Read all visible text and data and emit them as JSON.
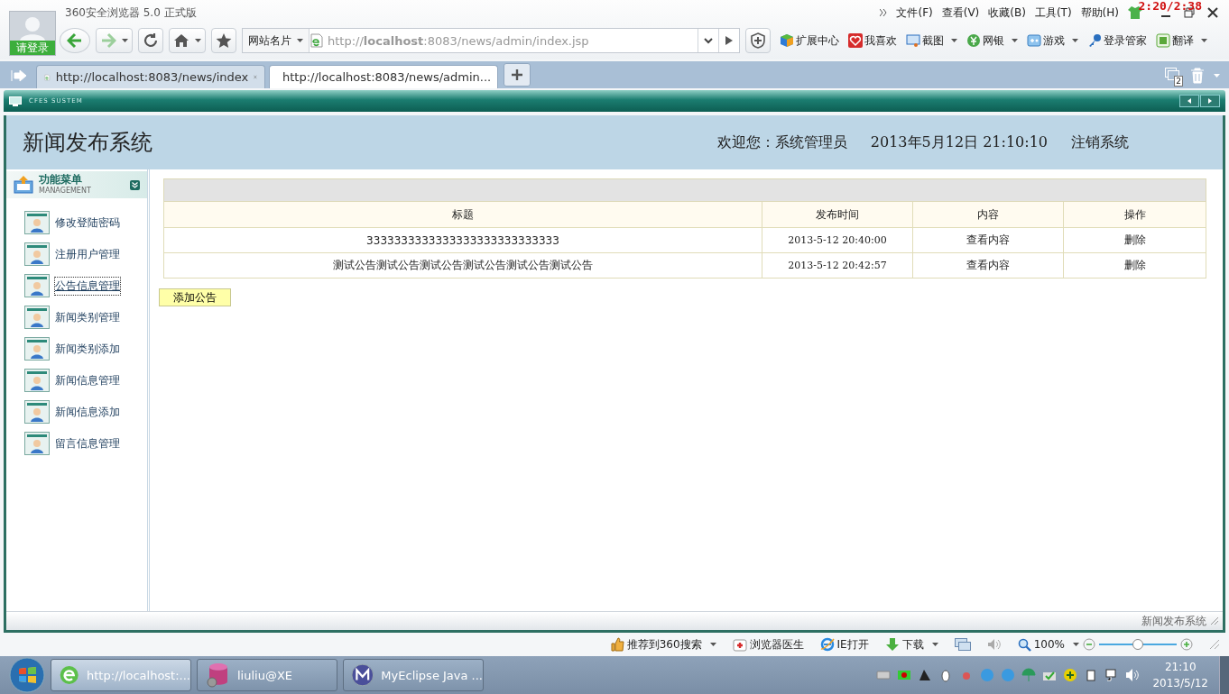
{
  "browser": {
    "title": "360安全浏览器 5.0 正式版",
    "login_label": "请登录",
    "timer": "2:20/2:38",
    "menu": [
      "文件(F)",
      "查看(V)",
      "收藏(B)",
      "工具(T)",
      "帮助(H)"
    ],
    "site_card": "网站名片",
    "address": "http://**localhost**:8083/news/admin/index.jsp",
    "toolbar_items": [
      {
        "kind": "cube",
        "label": "扩展中心",
        "dropdown": false
      },
      {
        "kind": "heart",
        "label": "我喜欢",
        "dropdown": false
      },
      {
        "kind": "screen",
        "label": "截图",
        "dropdown": true
      },
      {
        "kind": "coin",
        "label": "网银",
        "dropdown": true
      },
      {
        "kind": "game",
        "label": "游戏",
        "dropdown": true
      },
      {
        "kind": "key",
        "label": "登录管家",
        "dropdown": false
      },
      {
        "kind": "translate",
        "label": "翻译",
        "dropdown": true
      }
    ],
    "tabs": [
      {
        "label": "http://localhost:8083/news/index",
        "selected": false
      },
      {
        "label": "http://localhost:8083/news/admin...",
        "selected": true
      }
    ],
    "window_count": "2"
  },
  "app": {
    "banner": "CFES SUSTEM",
    "title": "新闻发布系统",
    "welcome": "欢迎您：系统管理员",
    "datetime": "2013年5月12日  21:10:10",
    "logout": "注销系统",
    "menu_title": "功能菜单",
    "menu_subtitle": "MANAGEMENT",
    "menu_items": [
      {
        "label": "修改登陆密码",
        "selected": false
      },
      {
        "label": "注册用户管理",
        "selected": false
      },
      {
        "label": "公告信息管理",
        "selected": true
      },
      {
        "label": "新闻类别管理",
        "selected": false
      },
      {
        "label": "新闻类别添加",
        "selected": false
      },
      {
        "label": "新闻信息管理",
        "selected": false
      },
      {
        "label": "新闻信息添加",
        "selected": false
      },
      {
        "label": "留言信息管理",
        "selected": false
      }
    ],
    "table": {
      "columns": [
        "标题",
        "发布时间",
        "内容",
        "操作"
      ],
      "rows": [
        [
          "3333333333333333333333333333",
          "2013-5-12 20:40:00",
          "查看内容",
          "删除"
        ],
        [
          "测试公告测试公告测试公告测试公告测试公告测试公告",
          "2013-5-12 20:42:57",
          "查看内容",
          "删除"
        ]
      ]
    },
    "add_button": "添加公告",
    "footer": "新闻发布系统"
  },
  "status_bar": {
    "items": [
      {
        "kind": "thumb",
        "label": "推荐到360搜索",
        "dropdown": true
      },
      {
        "kind": "doctor",
        "label": "浏览器医生",
        "dropdown": false
      },
      {
        "kind": "ie",
        "label": "IE打开",
        "dropdown": false
      },
      {
        "kind": "download",
        "label": "下载",
        "dropdown": true
      }
    ],
    "zoom": "100%",
    "zoom_slider": {
      "level": 0.5
    }
  },
  "taskbar": {
    "items": [
      {
        "kind": "browser",
        "label": "http://localhost:...",
        "selected": true
      },
      {
        "kind": "database",
        "label": "liuliu@XE",
        "selected": false
      },
      {
        "kind": "eclipse",
        "label": "MyEclipse Java ...",
        "selected": false
      }
    ],
    "time": "21:10",
    "date": "2013/5/12"
  }
}
